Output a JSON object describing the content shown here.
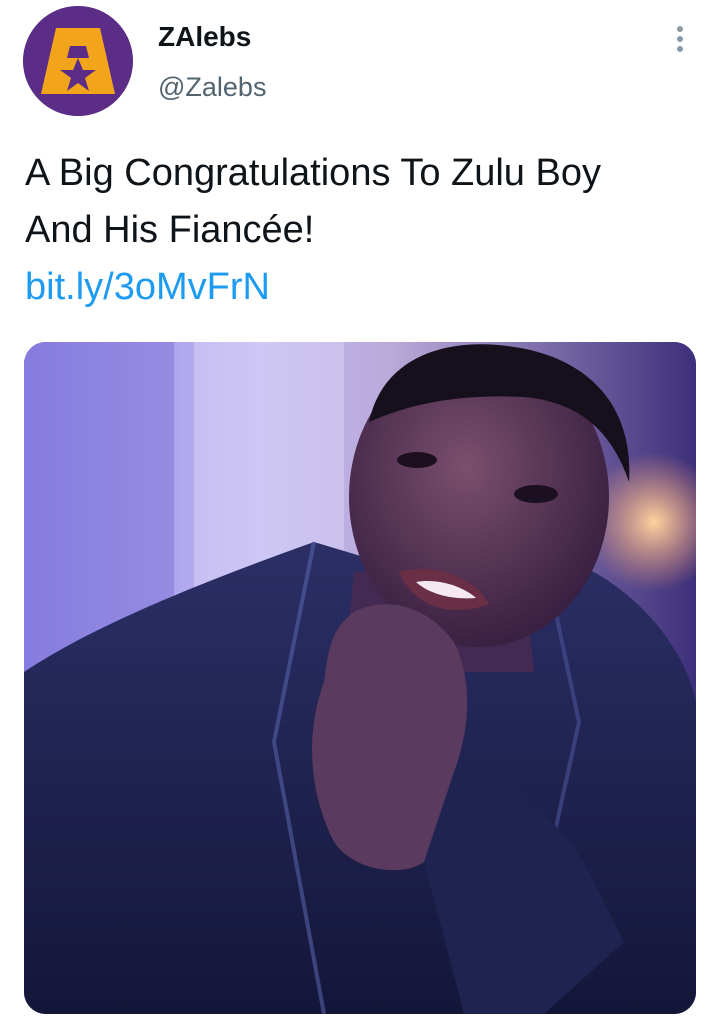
{
  "tweet": {
    "display_name": "ZAlebs",
    "handle": "@Zalebs",
    "text_lines": [
      "A Big Congratulations To Zulu Boy",
      "And His Fiancée!"
    ],
    "link": "bit.ly/3oMvFrN",
    "avatar_icon": "zalebs-star-logo",
    "more_icon": "more-vertical-icon",
    "media_description_icon": "photo"
  },
  "colors": {
    "link": "#1d9bf0",
    "avatar_bg": "#5b2d86",
    "avatar_logo": "#f2a51a",
    "text": "#0f1419",
    "secondary_text": "#536471"
  }
}
